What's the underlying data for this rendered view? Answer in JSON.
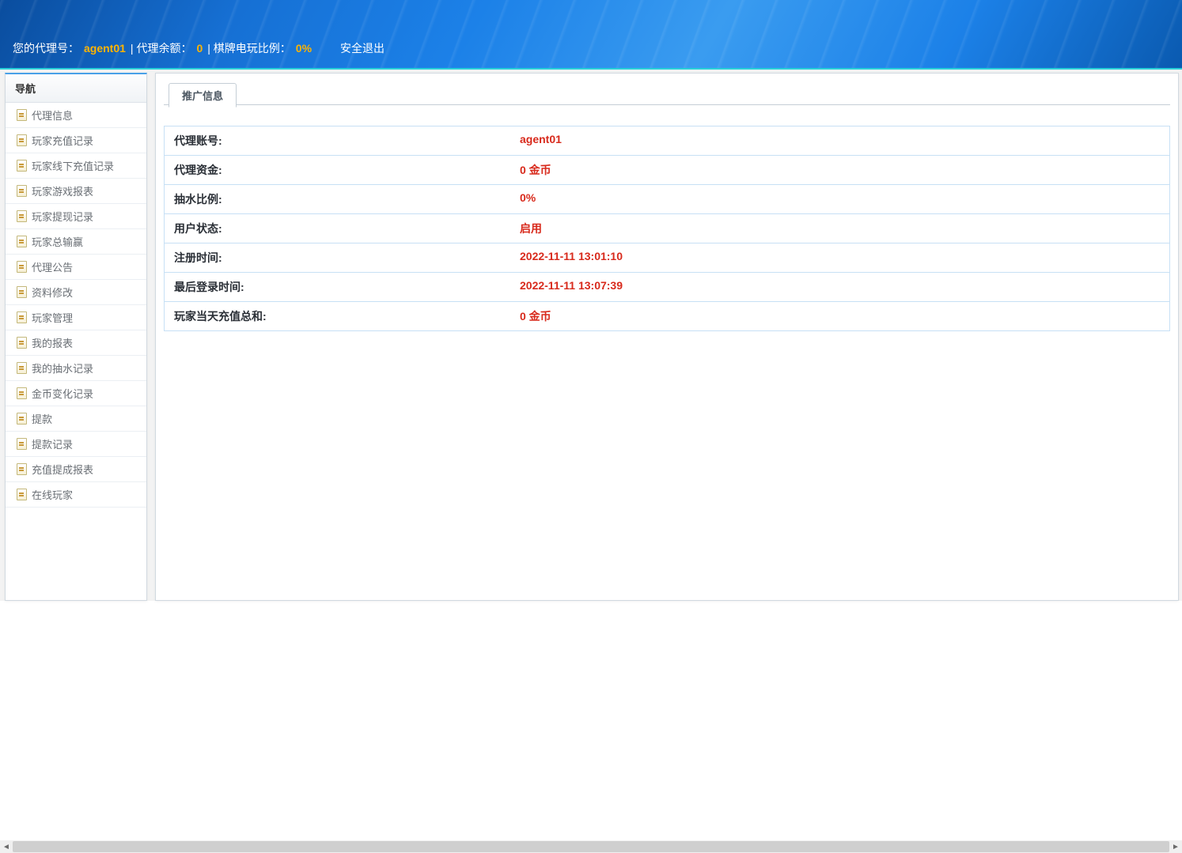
{
  "header": {
    "agent_label": "您的代理号：",
    "agent_id": "agent01",
    "balance_label": " | 代理余额：",
    "balance": "0",
    "ratio_label": " | 棋牌电玩比例：",
    "ratio": "0%",
    "logout": "安全退出"
  },
  "sidebar": {
    "title": "导航",
    "items": [
      {
        "label": "代理信息"
      },
      {
        "label": "玩家充值记录"
      },
      {
        "label": "玩家线下充值记录"
      },
      {
        "label": "玩家游戏报表"
      },
      {
        "label": "玩家提现记录"
      },
      {
        "label": "玩家总输赢"
      },
      {
        "label": "代理公告"
      },
      {
        "label": "资料修改"
      },
      {
        "label": "玩家管理"
      },
      {
        "label": "我的报表"
      },
      {
        "label": "我的抽水记录"
      },
      {
        "label": "金币变化记录"
      },
      {
        "label": "提款"
      },
      {
        "label": "提款记录"
      },
      {
        "label": "充值提成报表"
      },
      {
        "label": "在线玩家"
      }
    ]
  },
  "main": {
    "tab": "推广信息",
    "rows": [
      {
        "label": "代理账号:",
        "value": "agent01"
      },
      {
        "label": "代理资金:",
        "value": "0 金币"
      },
      {
        "label": "抽水比例:",
        "value": "0%"
      },
      {
        "label": "用户状态:",
        "value": "启用"
      },
      {
        "label": "注册时间:",
        "value": "2022-11-11 13:01:10"
      },
      {
        "label": "最后登录时间:",
        "value": "2022-11-11 13:07:39"
      },
      {
        "label": "玩家当天充值总和:",
        "value": "0 金币"
      }
    ]
  }
}
